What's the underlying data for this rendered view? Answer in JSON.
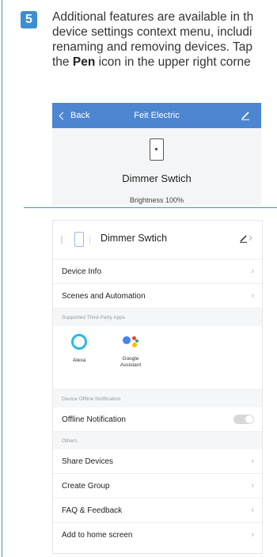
{
  "step": {
    "number": "5"
  },
  "instruction": {
    "line1": "Additional features are available in th",
    "line2": "device settings context menu, includi",
    "line3": "renaming and removing devices. Tap",
    "line4_pre": "the ",
    "line4_bold": "Pen",
    "line4_post": " icon in the upper right corne"
  },
  "top_screen": {
    "back_label": "Back",
    "title": "Feit Electric",
    "device_name": "Dimmer Swtich",
    "brightness": "Brightness 100%"
  },
  "settings": {
    "device_name": "Dimmer Swtich",
    "rows_top": [
      {
        "label": "Device Info"
      },
      {
        "label": "Scenes and Automation"
      }
    ],
    "section_apps": "Supported Third-Party Apps",
    "apps": [
      {
        "label": "Alexa",
        "icon": "alexa-icon"
      },
      {
        "label": "Google\nAssistant",
        "icon": "google-assistant-icon"
      }
    ],
    "section_offline": "Device Offline Notification",
    "offline_label": "Offline Notification",
    "offline_enabled": false,
    "section_others": "Others",
    "rows_others": [
      {
        "label": "Share Devices"
      },
      {
        "label": "Create Group"
      },
      {
        "label": "FAQ & Feedback"
      },
      {
        "label": "Add to home screen"
      }
    ]
  },
  "colors": {
    "accent": "#4c86d1",
    "badge": "#3d8ed0",
    "alexa": "#29b8e8",
    "google_blue": "#4285f4",
    "google_red": "#ea4335",
    "google_yellow": "#fbbc05",
    "google_green": "#34a853"
  }
}
